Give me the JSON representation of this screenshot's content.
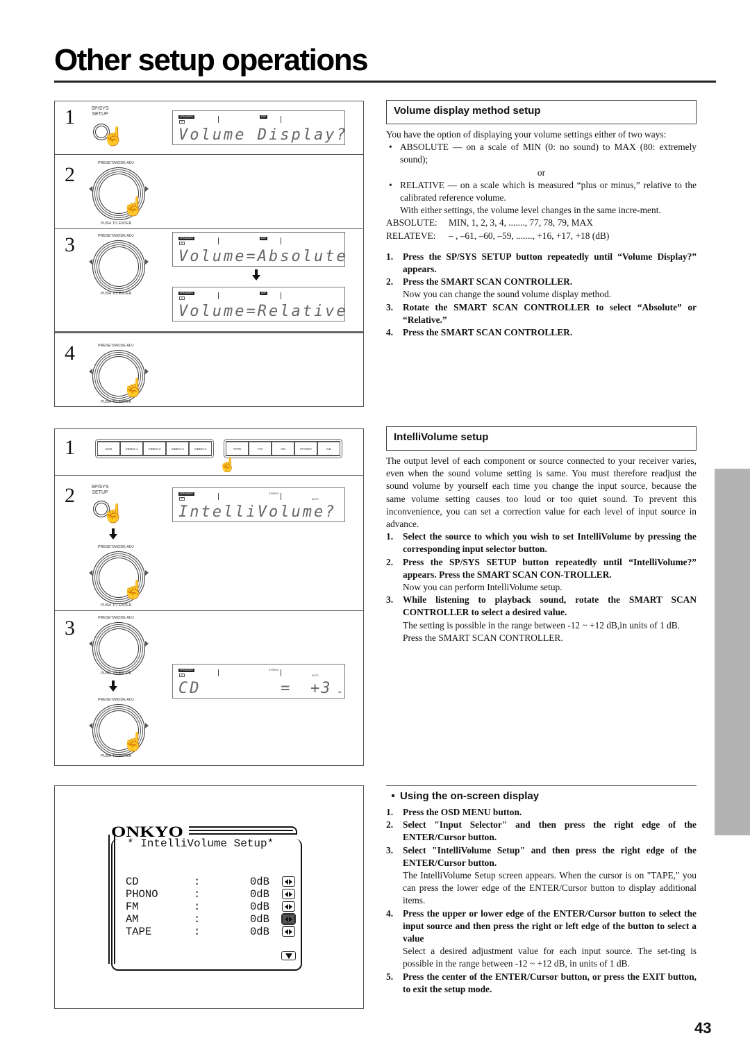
{
  "page": {
    "title": "Other setup operations",
    "page_number": "43"
  },
  "volume_display_diagram": {
    "steps": [
      {
        "num": "1",
        "button_label": "SP/SYS\nSETUP",
        "display": "Volume Display?"
      },
      {
        "num": "2",
        "knob_top": "PRESET/MODE ADJ",
        "knob_bottom": "PUSH TO ENTER"
      },
      {
        "num": "3",
        "knob_top": "PRESET/MODE ADJ",
        "knob_bottom": "PUSH TO ENTER",
        "display_before": "Volume=Absolute",
        "display_after": "Volume=Relative"
      },
      {
        "num": "4",
        "knob_top": "PRESET/MODE ADJ",
        "knob_bottom": "PUSH TO ENTER"
      }
    ],
    "lcd_tags": {
      "speakers": "SPEAKERS",
      "a": "A",
      "dsp": "DSP"
    }
  },
  "intellivolume_diagram": {
    "step1": {
      "num": "1",
      "selectors_left": [
        "DVD",
        "VIDEO-1",
        "VIDEO-2",
        "VIDEO-3",
        "VIDEO-4"
      ],
      "selectors_right": [
        "TAPE",
        "FM",
        "AM",
        "PHONO",
        "CD"
      ]
    },
    "step2": {
      "num": "2",
      "button_label": "SP/SYS\nSETUP",
      "display": "IntelliVolume?",
      "knob_top": "PRESET/MODE ADJ",
      "knob_bottom": "PUSH TO ENTER"
    },
    "step3": {
      "num": "3",
      "knob_top": "PRESET/MODE ADJ",
      "knob_bottom": "PUSH TO ENTER",
      "knob2_top": "PRESET/MODE ADJ",
      "knob2_bottom": "PUSH TO ENTER",
      "display_source": "CD",
      "display_sign": "=",
      "display_value": "+3",
      "display_unit": "dB"
    },
    "lcd_tags": {
      "speakers": "SPEAKERS",
      "a": "A",
      "stereo": "STEREO",
      "auto": "AUTO"
    }
  },
  "osd": {
    "logo": "ONKYO",
    "title": "* IntelliVolume Setup*",
    "rows": [
      {
        "source": "CD",
        "sep": ":",
        "value": "0dB",
        "selected": false
      },
      {
        "source": "PHONO",
        "sep": ":",
        "value": "0dB",
        "selected": false
      },
      {
        "source": "FM",
        "sep": ":",
        "value": "0dB",
        "selected": false
      },
      {
        "source": "AM",
        "sep": ":",
        "value": "0dB",
        "selected": true
      },
      {
        "source": "TAPE",
        "sep": ":",
        "value": "0dB",
        "selected": false
      }
    ]
  },
  "volume_display_section": {
    "heading": "Volume display method setup",
    "intro": "You have the option of displaying your volume settings either of two ways:",
    "bullet1": "ABSOLUTE — on a scale of MIN (0: no sound) to MAX (80: extremely sound);",
    "or": "or",
    "bullet2": "RELATIVE — on a scale which is measured “plus or minus,” relative to the calibrated reference volume.",
    "bullet2_note": "With either settings, the volume level changes in the same incre-ment.",
    "absolute_key": "ABSOLUTE:",
    "absolute_val": "MIN, 1, 2, 3, 4, ......., 77, 78, 79, MAX",
    "relative_key": "RELATEVE:",
    "relative_val": "–  , –61, –60, –59, ......., +16, +17, +18 (dB)",
    "steps": [
      {
        "num": "1.",
        "text": "Press the SP/SYS SETUP button repeatedly until “Volume Display?” appears.",
        "note": ""
      },
      {
        "num": "2.",
        "text": "Press the SMART SCAN CONTROLLER.",
        "note": "Now you can change the sound volume display method."
      },
      {
        "num": "3.",
        "text": "Rotate the SMART SCAN CONTROLLER to select “Absolute” or “Relative.”",
        "note": ""
      },
      {
        "num": "4.",
        "text": "Press the SMART SCAN CONTROLLER.",
        "note": ""
      }
    ]
  },
  "intellivolume_section": {
    "heading": "IntelliVolume setup",
    "intro": "The output level of each component or source connected to your receiver varies, even when the sound volume setting is same. You must therefore readjust the sound volume by yourself each time you change the input source, because the same volume setting causes too loud or too quiet sound. To prevent this inconvenience, you can set a correction value for each level of input source in advance.",
    "steps": [
      {
        "num": "1.",
        "text": "Select the source to which you wish to set IntelliVolume by pressing the corresponding input selector button.",
        "note": ""
      },
      {
        "num": "2.",
        "text": "Press the SP/SYS SETUP button repeatedly until “IntelliVolume?” appears. Press the SMART SCAN CON-TROLLER.",
        "note": "Now you can perform IntelliVolume setup."
      },
      {
        "num": "3.",
        "text": "While listening to playback sound, rotate the SMART SCAN CONTROLLER to select a desired value.",
        "note": "The setting is possible in the range between -12 ~ +12 dB,in units of 1 dB.",
        "note2": "Press the SMART SCAN CONTROLLER."
      }
    ]
  },
  "osd_section": {
    "bullet": "•",
    "heading": "Using the on-screen display",
    "steps": [
      {
        "num": "1.",
        "text": "Press the OSD MENU button.",
        "note": ""
      },
      {
        "num": "2.",
        "text": "Select \"Input Selector\" and then press the right edge of the ENTER/Cursor button.",
        "note": ""
      },
      {
        "num": "3.",
        "text": "Select \"IntelliVolume Setup\" and then press the right edge of the ENTER/Cursor button.",
        "note": "The IntelliVolume Setup screen appears. When the cursor is on \"TAPE,\" you can press the lower edge of the ENTER/Cursor button to display additional items."
      },
      {
        "num": "4.",
        "text": "Press the upper or lower edge of the ENTER/Cursor button to select the input source and then press the right or left edge of the button to select a value",
        "note": "Select a desired adjustment value for each input source. The set-ting is possible in the range between -12 ~ +12 dB, in units of 1 dB."
      },
      {
        "num": "5.",
        "text": "Press the center of the ENTER/Cursor button, or press the EXIT button, to exit the setup mode.",
        "note": ""
      }
    ]
  },
  "colors": {
    "side_tab": "#b3b3b3",
    "osd_selected": "#555555"
  }
}
